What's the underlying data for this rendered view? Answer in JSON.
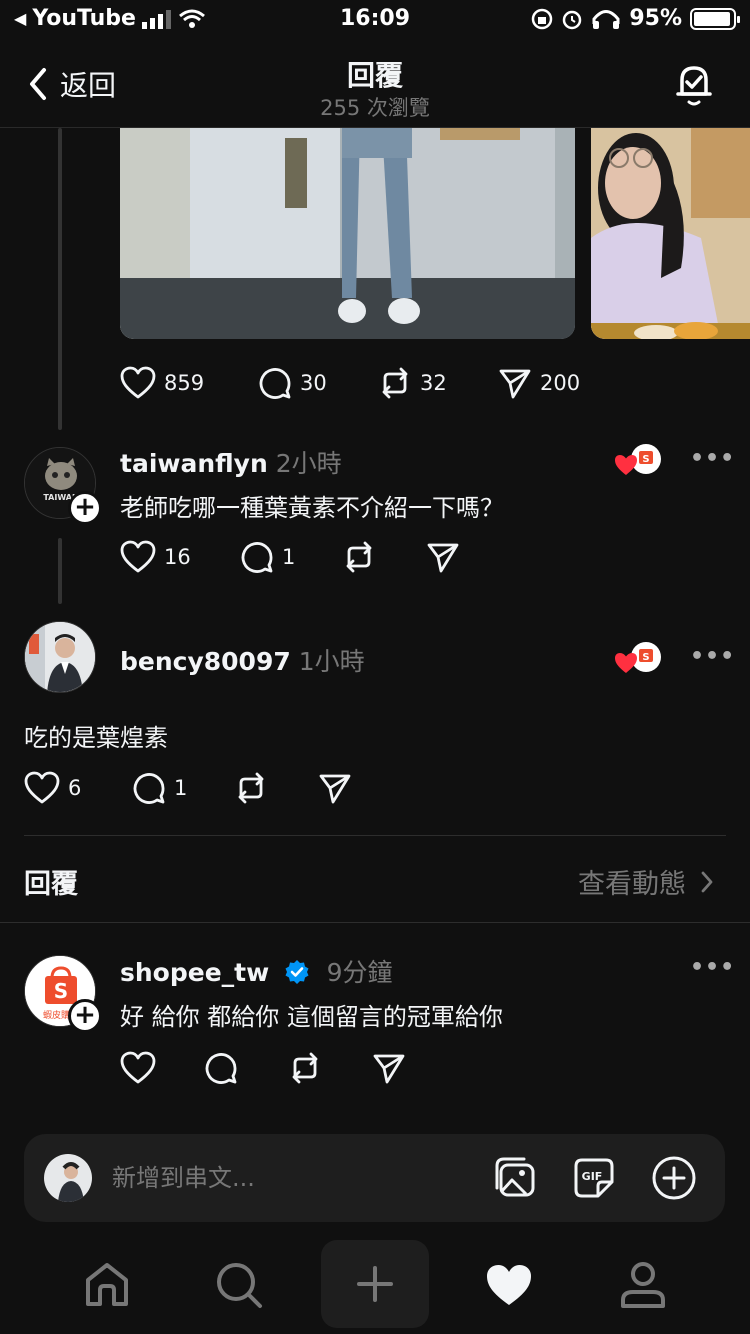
{
  "status_bar": {
    "back_app": "YouTube",
    "time": "16:09",
    "battery": "95%"
  },
  "header": {
    "back_label": "返回",
    "title": "回覆",
    "views": "255 次瀏覽"
  },
  "post": {
    "stats": {
      "likes": "859",
      "comments": "30",
      "reposts": "32",
      "shares": "200"
    }
  },
  "comments": [
    {
      "username": "taiwanflyn",
      "time": "2小時",
      "avatar_text": "TAIWAN",
      "text": "老師吃哪一種葉黃素不介紹一下嗎？",
      "likes": "16",
      "comments": "1"
    },
    {
      "username": "bency80097",
      "time": "1小時",
      "text": "吃的是葉煌素",
      "likes": "6",
      "comments": "1"
    }
  ],
  "replies_section": {
    "title": "回覆",
    "activity_link": "查看動態"
  },
  "reply": {
    "username": "shopee_tw",
    "time": "9分鐘",
    "avatar_text": "蝦皮購物",
    "text": "好 給你 都給你 這個留言的冠軍給你"
  },
  "composer": {
    "placeholder": "新增到串文..."
  },
  "colors": {
    "background": "#101010",
    "text": "#f3f5f7",
    "muted": "#777777",
    "verified": "#0095f6",
    "shopee": "#ee4d2d",
    "heart": "#ff3040"
  }
}
